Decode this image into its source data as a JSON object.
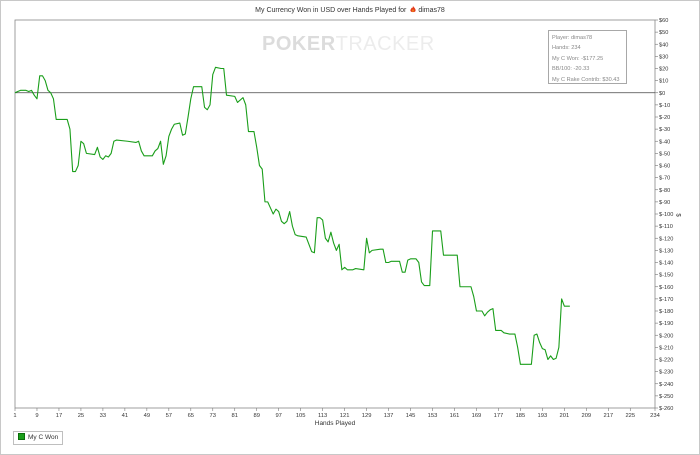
{
  "chart_data": {
    "type": "line",
    "title": "My Currency Won in USD over Hands Played for",
    "player_name": "dimas78",
    "xlabel": "Hands Played",
    "ylabel": "$",
    "xlim": [
      1,
      234
    ],
    "ylim": [
      -260,
      60
    ],
    "x_ticks": [
      1,
      9,
      17,
      25,
      33,
      41,
      49,
      57,
      65,
      73,
      81,
      89,
      97,
      105,
      113,
      121,
      129,
      137,
      145,
      153,
      161,
      169,
      177,
      185,
      193,
      201,
      209,
      217,
      225,
      234
    ],
    "x_tick_labels": [
      "1",
      "9",
      "17",
      "25",
      "33",
      "41",
      "49",
      "57",
      "65",
      "73",
      "81",
      "89",
      "97",
      "105",
      "113",
      "121",
      "129",
      "137",
      "145",
      "153",
      "161",
      "169",
      "177",
      "185",
      "193",
      "201",
      "209",
      "217",
      "225",
      "234"
    ],
    "y_ticks": [
      60,
      50,
      40,
      30,
      20,
      10,
      0,
      -10,
      -20,
      -30,
      -40,
      -50,
      -60,
      -70,
      -80,
      -90,
      -100,
      -110,
      -120,
      -130,
      -140,
      -150,
      -160,
      -170,
      -180,
      -190,
      -200,
      -210,
      -220,
      -230,
      -240,
      -250,
      -260
    ],
    "y_tick_labels": [
      "$60",
      "$50",
      "$40",
      "$30",
      "$20",
      "$10",
      "$0",
      "$-10",
      "$-20",
      "$-30",
      "$-40",
      "$-50",
      "$-60",
      "$-70",
      "$-80",
      "$-90",
      "$-100",
      "$-110",
      "$-120",
      "$-130",
      "$-140",
      "$-150",
      "$-160",
      "$-170",
      "$-180",
      "$-190",
      "$-200",
      "$-210",
      "$-220",
      "$-230",
      "$-240",
      "$-250",
      "$-260"
    ],
    "y_axis_side": "right",
    "zero_line": true,
    "grid": false,
    "legend_position": "bottom-left",
    "series": [
      {
        "name": "My C Won",
        "color": "#1a9e1a",
        "points": [
          [
            1,
            0
          ],
          [
            2,
            1
          ],
          [
            3,
            2
          ],
          [
            5,
            2
          ],
          [
            6,
            1
          ],
          [
            7,
            2
          ],
          [
            8,
            -2
          ],
          [
            9,
            -5
          ],
          [
            10,
            14
          ],
          [
            11,
            14
          ],
          [
            12,
            10
          ],
          [
            13,
            2
          ],
          [
            14,
            0
          ],
          [
            15,
            -5
          ],
          [
            16,
            -22
          ],
          [
            20,
            -22
          ],
          [
            21,
            -30
          ],
          [
            22,
            -65
          ],
          [
            23,
            -65
          ],
          [
            24,
            -60
          ],
          [
            25,
            -40
          ],
          [
            26,
            -42
          ],
          [
            27,
            -50
          ],
          [
            30,
            -51
          ],
          [
            31,
            -45
          ],
          [
            32,
            -53
          ],
          [
            33,
            -55
          ],
          [
            34,
            -52
          ],
          [
            35,
            -53
          ],
          [
            36,
            -50
          ],
          [
            37,
            -40
          ],
          [
            38,
            -39
          ],
          [
            42,
            -40
          ],
          [
            45,
            -41
          ],
          [
            46,
            -40
          ],
          [
            47,
            -48
          ],
          [
            48,
            -52
          ],
          [
            51,
            -52
          ],
          [
            52,
            -48
          ],
          [
            53,
            -46
          ],
          [
            54,
            -40
          ],
          [
            55,
            -59
          ],
          [
            56,
            -52
          ],
          [
            57,
            -36
          ],
          [
            58,
            -30
          ],
          [
            59,
            -26
          ],
          [
            61,
            -25
          ],
          [
            62,
            -35
          ],
          [
            63,
            -34
          ],
          [
            64,
            -20
          ],
          [
            65,
            -5
          ],
          [
            66,
            5
          ],
          [
            69,
            5
          ],
          [
            70,
            -12
          ],
          [
            71,
            -14
          ],
          [
            72,
            -10
          ],
          [
            73,
            15
          ],
          [
            74,
            21
          ],
          [
            76,
            20
          ],
          [
            77,
            20
          ],
          [
            78,
            -2
          ],
          [
            81,
            -3
          ],
          [
            82,
            -8
          ],
          [
            84,
            -4
          ],
          [
            85,
            -10
          ],
          [
            86,
            -32
          ],
          [
            88,
            -32
          ],
          [
            89,
            -45
          ],
          [
            90,
            -60
          ],
          [
            91,
            -63
          ],
          [
            92,
            -90
          ],
          [
            93,
            -90
          ],
          [
            94,
            -95
          ],
          [
            95,
            -100
          ],
          [
            96,
            -96
          ],
          [
            97,
            -98
          ],
          [
            98,
            -106
          ],
          [
            99,
            -108
          ],
          [
            100,
            -106
          ],
          [
            101,
            -98
          ],
          [
            102,
            -110
          ],
          [
            103,
            -117
          ],
          [
            104,
            -118
          ],
          [
            107,
            -119
          ],
          [
            108,
            -125
          ],
          [
            109,
            -131
          ],
          [
            110,
            -132
          ],
          [
            111,
            -103
          ],
          [
            112,
            -103
          ],
          [
            113,
            -105
          ],
          [
            114,
            -120
          ],
          [
            115,
            -123
          ],
          [
            116,
            -115
          ],
          [
            117,
            -124
          ],
          [
            118,
            -130
          ],
          [
            119,
            -125
          ],
          [
            120,
            -146
          ],
          [
            121,
            -144
          ],
          [
            122,
            -146
          ],
          [
            124,
            -146
          ],
          [
            125,
            -145
          ],
          [
            128,
            -146
          ],
          [
            129,
            -120
          ],
          [
            130,
            -132
          ],
          [
            131,
            -130
          ],
          [
            134,
            -129
          ],
          [
            135,
            -129
          ],
          [
            136,
            -140
          ],
          [
            137,
            -140
          ],
          [
            138,
            -139
          ],
          [
            141,
            -139
          ],
          [
            142,
            -148
          ],
          [
            143,
            -148
          ],
          [
            144,
            -138
          ],
          [
            145,
            -137
          ],
          [
            147,
            -137
          ],
          [
            148,
            -140
          ],
          [
            149,
            -156
          ],
          [
            150,
            -159
          ],
          [
            152,
            -159
          ],
          [
            153,
            -114
          ],
          [
            156,
            -114
          ],
          [
            157,
            -134
          ],
          [
            158,
            -134
          ],
          [
            162,
            -134
          ],
          [
            163,
            -160
          ],
          [
            164,
            -160
          ],
          [
            167,
            -160
          ],
          [
            168,
            -168
          ],
          [
            169,
            -180
          ],
          [
            171,
            -180
          ],
          [
            172,
            -184
          ],
          [
            173,
            -181
          ],
          [
            174,
            -179
          ],
          [
            175,
            -178
          ],
          [
            176,
            -196
          ],
          [
            178,
            -196
          ],
          [
            179,
            -198
          ],
          [
            181,
            -199
          ],
          [
            183,
            -199
          ],
          [
            184,
            -210
          ],
          [
            185,
            -224
          ],
          [
            189,
            -224
          ],
          [
            190,
            -200
          ],
          [
            191,
            -199
          ],
          [
            192,
            -206
          ],
          [
            193,
            -211
          ],
          [
            194,
            -212
          ],
          [
            195,
            -220
          ],
          [
            196,
            -217
          ],
          [
            197,
            -220
          ],
          [
            198,
            -219
          ],
          [
            199,
            -210
          ],
          [
            200,
            -170
          ],
          [
            201,
            -176
          ],
          [
            203,
            -176
          ]
        ]
      }
    ]
  },
  "info_box": {
    "player": "Player: dimas78",
    "hands": "Hands: 234",
    "won": "My C Won: -$177.25",
    "bb100": "BB/100: -20.33",
    "rake": "My C Rake Contrib: $30.43"
  },
  "watermark": {
    "part1": "PO",
    "part2": "KER",
    "part3": "TRACKER"
  },
  "legend": {
    "label": "My C Won"
  }
}
